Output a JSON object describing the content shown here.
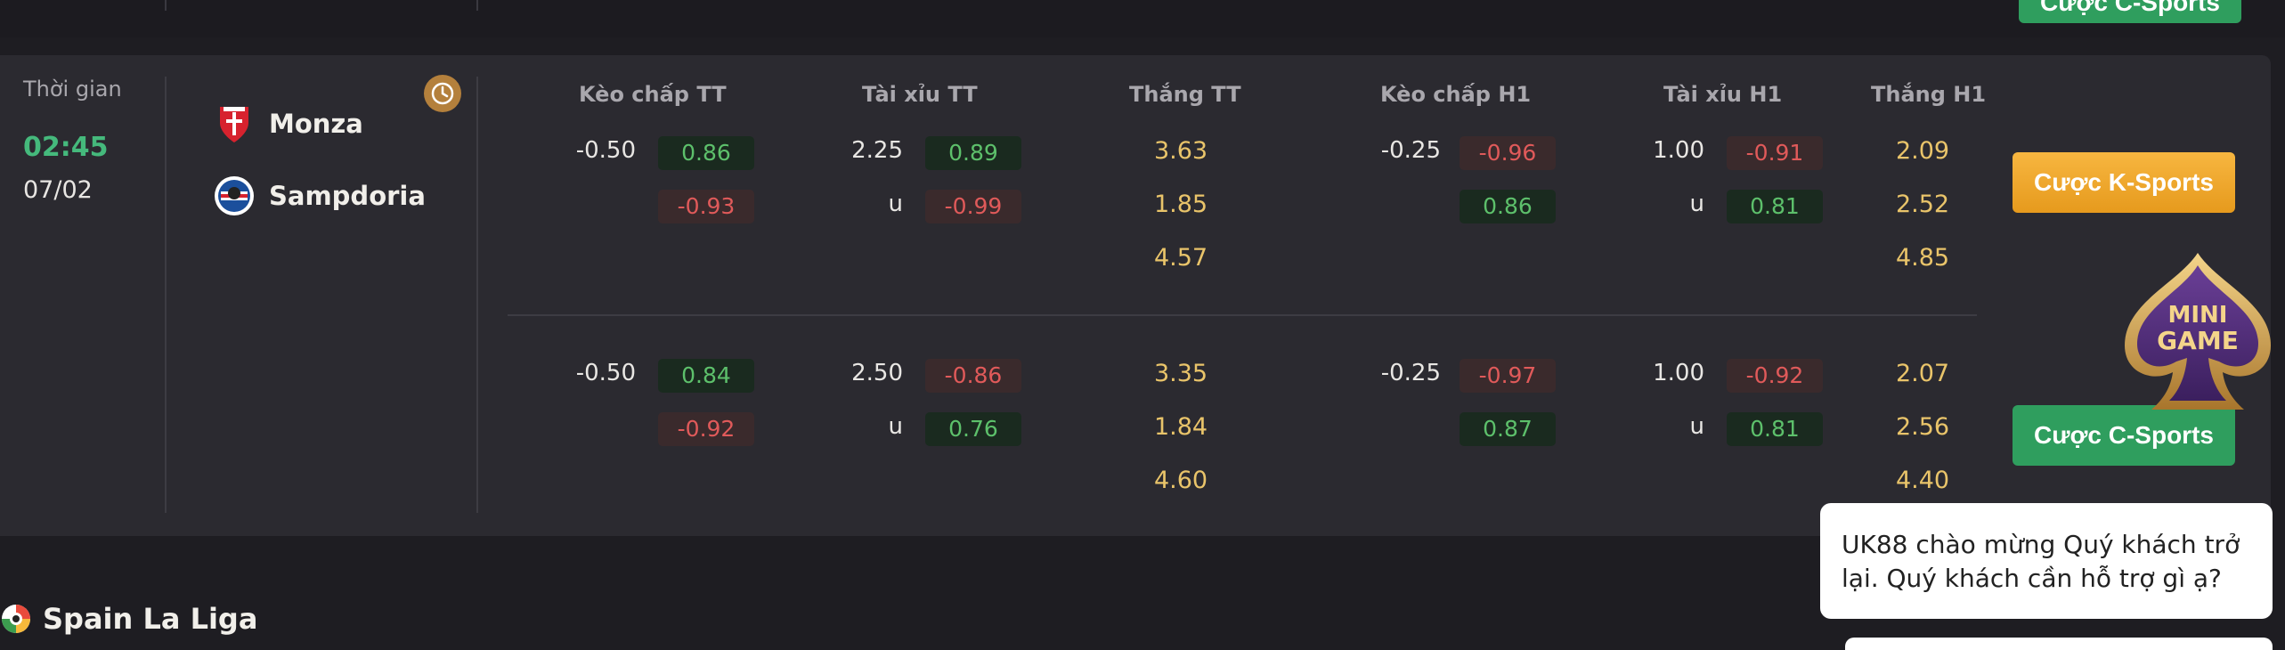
{
  "top_strip": {
    "fragment_1": "...",
    "fragment_2": "...",
    "csports_label": "Cược C-Sports"
  },
  "match": {
    "time_label": "Thời gian",
    "time": "02:45",
    "date": "07/02",
    "home_team": "Monza",
    "away_team": "Sampdoria",
    "columns": [
      "Kèo chấp TT",
      "Tài xỉu TT",
      "Thắng TT",
      "Kèo chấp H1",
      "Tài xỉu H1",
      "Thắng H1"
    ],
    "rows": [
      {
        "handicap_tt": {
          "line": "-0.50",
          "home": "0.86",
          "away": "-0.93"
        },
        "ou_tt": {
          "line": "2.25",
          "over": "0.89",
          "under_label": "u",
          "under": "-0.99"
        },
        "win_tt": [
          "3.63",
          "1.85",
          "4.57"
        ],
        "handicap_h1": {
          "line": "-0.25",
          "home": "-0.96",
          "away": "0.86"
        },
        "ou_h1": {
          "line": "1.00",
          "over": "-0.91",
          "under_label": "u",
          "under": "0.81"
        },
        "win_h1": [
          "2.09",
          "2.52",
          "4.85"
        ]
      },
      {
        "handicap_tt": {
          "line": "-0.50",
          "home": "0.84",
          "away": "-0.92"
        },
        "ou_tt": {
          "line": "2.50",
          "over": "-0.86",
          "under_label": "u",
          "under": "0.76"
        },
        "win_tt": [
          "3.35",
          "1.84",
          "4.60"
        ],
        "handicap_h1": {
          "line": "-0.25",
          "home": "-0.97",
          "away": "0.87"
        },
        "ou_h1": {
          "line": "1.00",
          "over": "-0.92",
          "under_label": "u",
          "under": "0.81"
        },
        "win_h1": [
          "2.07",
          "2.56",
          "4.40"
        ]
      }
    ],
    "buttons": {
      "k_sports": "Cược K-Sports",
      "c_sports": "Cược C-Sports"
    }
  },
  "mini_game": {
    "line1": "MINI",
    "line2": "GAME"
  },
  "league": {
    "name": "Spain La Liga"
  },
  "chat": {
    "message": "UK88 chào mừng Quý khách trở lại. Quý khách cần hỗ trợ gì ạ?"
  },
  "colors": {
    "positive": "#5dc06b",
    "negative": "#e05a5a",
    "win": "#e9c46a",
    "green_button": "#2f9e5e",
    "orange_button": "#f7b640",
    "time": "#45b97c"
  }
}
